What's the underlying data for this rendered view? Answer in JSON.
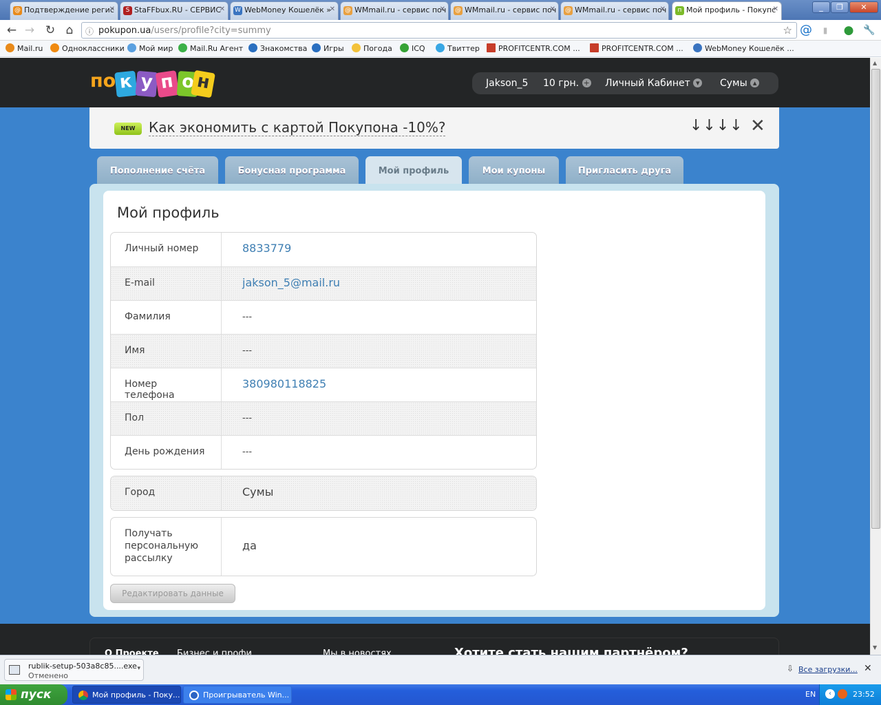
{
  "browser": {
    "tabs": [
      {
        "title": "Подтверждение регис",
        "icon": "mailru"
      },
      {
        "title": "StaFFbux.RU - СЕРВИС",
        "icon": "staffbux"
      },
      {
        "title": "WebMoney Кошелёк »",
        "icon": "webmoney"
      },
      {
        "title": "WMmail.ru - сервис поч",
        "icon": "wmmail"
      },
      {
        "title": "WMmail.ru - сервис поч",
        "icon": "wmmail"
      },
      {
        "title": "WMmail.ru - сервис поч",
        "icon": "wmmail"
      },
      {
        "title": "Мой профиль - Покупс",
        "icon": "pokupon",
        "active": true
      }
    ],
    "url_host": "pokupon.ua",
    "url_path": "/users/profile?city=summy",
    "bookmarks": [
      "Mail.ru",
      "Одноклассники",
      "Мой мир",
      "Mail.Ru Агент",
      "Знакомства",
      "Игры",
      "Погода",
      "ICQ",
      "Твиттер",
      "PROFITCENTR.COM ...",
      "PROFITCENTR.COM ...",
      "WebMoney Кошелёк ..."
    ]
  },
  "site": {
    "logo_letters": [
      "по",
      "к",
      "у",
      "п",
      "о",
      "н"
    ],
    "user": {
      "name": "Jakson_5",
      "balance": "10 грн.",
      "cabinet": "Личный Кабинет",
      "city": "Сумы"
    },
    "promo": {
      "badge": "NEW",
      "text": "Как экономить с картой Покупона -10%?",
      "arrows": "↓↓↓↓"
    },
    "tabs": [
      {
        "label": "Пополнение счёта"
      },
      {
        "label": "Бонусная программа"
      },
      {
        "label": "Мой профиль",
        "active": true
      },
      {
        "label": "Мои купоны"
      },
      {
        "label": "Пригласить друга"
      }
    ],
    "profile": {
      "title": "Мой профиль",
      "rows": [
        {
          "label": "Личный номер",
          "value": "8833779"
        },
        {
          "label": "E-mail",
          "value": "jakson_5@mail.ru"
        },
        {
          "label": "Фамилия",
          "value": "---"
        },
        {
          "label": "Имя",
          "value": "---"
        },
        {
          "label": "Номер телефона",
          "value": "380980118825"
        },
        {
          "label": "Пол",
          "value": "---"
        },
        {
          "label": "День рождения",
          "value": "---"
        }
      ],
      "city": {
        "label": "Город",
        "value": "Сумы"
      },
      "mailing": {
        "label": "Получать персональную рассылку",
        "value": "да"
      },
      "edit_button": "Редактировать данные"
    },
    "footer_items": [
      "О Проекте",
      "Бизнес и профи",
      "Мы в новостях",
      "Хотите стать нашим партнёром?"
    ]
  },
  "downloads": {
    "file": "rublik-setup-503a8c85....exe",
    "status": "Отменено",
    "all": "Все загрузки..."
  },
  "taskbar": {
    "start": "пуск",
    "tasks": [
      "Мой профиль - Поку...",
      "Проигрыватель Win..."
    ],
    "lang": "EN",
    "time": "23:52"
  }
}
